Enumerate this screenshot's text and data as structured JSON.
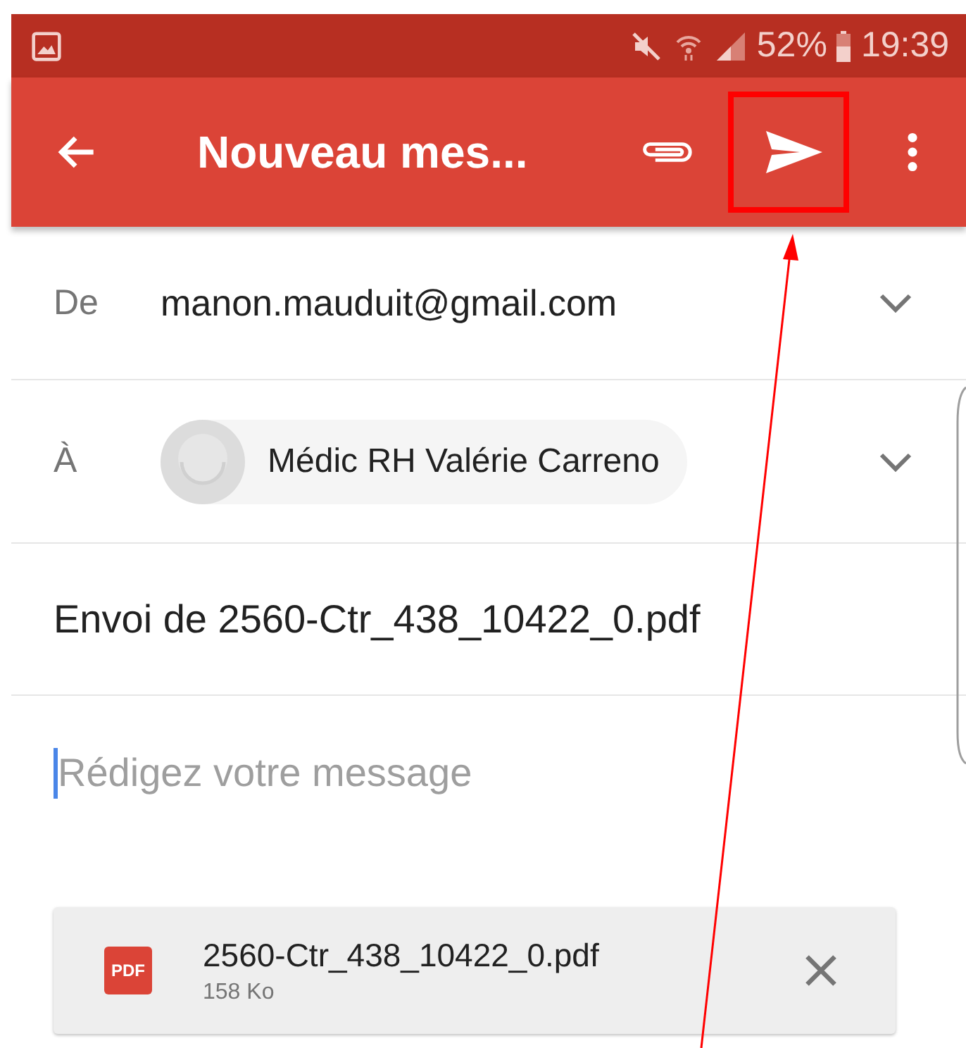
{
  "status_bar": {
    "battery": "52%",
    "time": "19:39"
  },
  "app_bar": {
    "title": "Nouveau mes..."
  },
  "fields": [
    {
      "kind": "from",
      "label": "De",
      "value": "manon.mauduit@gmail.com"
    },
    {
      "kind": "to",
      "label": "À",
      "value": "Médic RH Valérie Carreno"
    }
  ],
  "subject": "Envoi de 2560-Ctr_438_10422_0.pdf",
  "body": {
    "placeholder": "Rédigez votre message"
  },
  "attachment": {
    "badge": "PDF",
    "name": "2560-Ctr_438_10422_0.pdf",
    "size": "158 Ko"
  }
}
